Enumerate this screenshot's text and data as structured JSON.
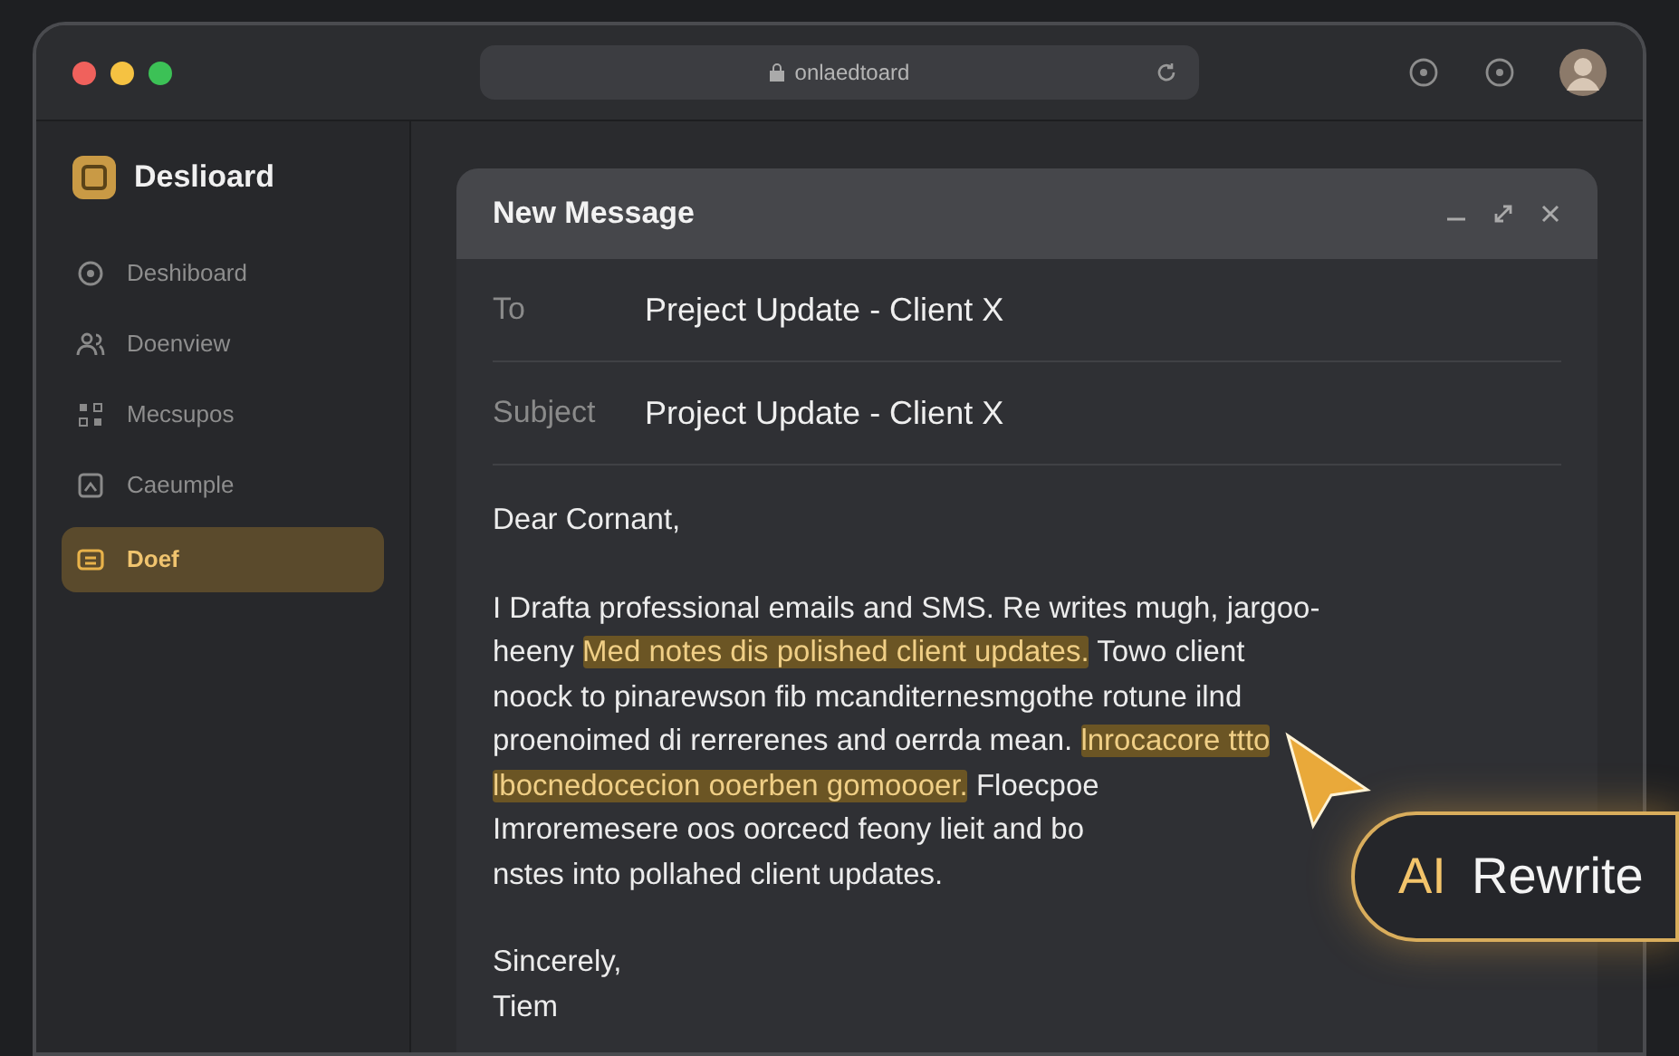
{
  "window": {
    "address": "onlaedtoard"
  },
  "sidebar": {
    "title": "Deslioard",
    "items": [
      {
        "label": "Deshiboard",
        "selected": false
      },
      {
        "label": "Doenview",
        "selected": false
      },
      {
        "label": "Mecsupos",
        "selected": false
      },
      {
        "label": "Caeumple",
        "selected": false
      },
      {
        "label": "Doef",
        "selected": true
      }
    ]
  },
  "compose": {
    "title": "New Message",
    "fields": [
      {
        "label": "To",
        "value": "Preject Update - Client X"
      },
      {
        "label": "Subject",
        "value": "Project Update - Client X"
      }
    ],
    "greeting": "Dear Cornant,",
    "body_lines": [
      [
        {
          "text": "I Drafta professional emails and SMS. Re writes mugh, jargoo-",
          "highlighted": false
        }
      ],
      [
        {
          "text": "heeny ",
          "highlighted": false
        },
        {
          "text": "Med notes dis polished client updates.",
          "highlighted": true
        },
        {
          "text": " Towo client",
          "highlighted": false
        }
      ],
      [
        {
          "text": "noock to pinarewson fib mcanditernesmgothe rotune ilnd",
          "highlighted": false
        }
      ],
      [
        {
          "text": "proenoimed di rerrerenes and oerrda mean. ",
          "highlighted": false
        },
        {
          "text": "lnrocacore ttto",
          "highlighted": true
        }
      ],
      [
        {
          "text": "lbocnedocecion ooerben gomoooer.",
          "highlighted": true
        },
        {
          "text": " Floecpoe",
          "highlighted": false
        }
      ],
      [
        {
          "text": "Imroremesere oos oorcecd feony lieit and bo",
          "highlighted": false
        }
      ],
      [
        {
          "text": "nstes into pollahed client updates.",
          "highlighted": false
        }
      ]
    ],
    "closing": "Sincerely,",
    "signature": "Tiem"
  },
  "ai_button": {
    "badge": "AI",
    "label": "Rewrite"
  }
}
